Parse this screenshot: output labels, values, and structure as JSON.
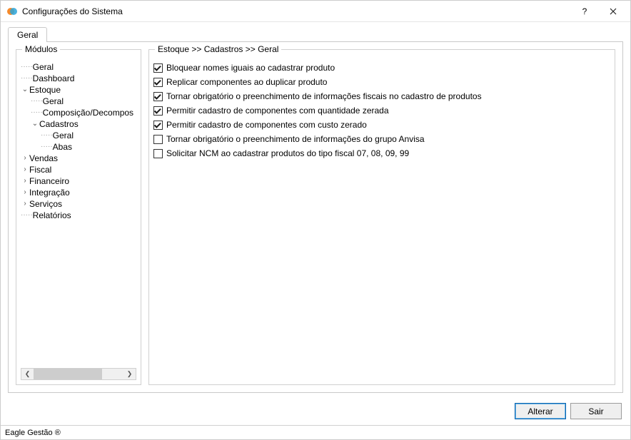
{
  "window": {
    "title": "Configurações do Sistema"
  },
  "tabs": {
    "geral": "Geral"
  },
  "sidebar": {
    "legend": "Módulos",
    "items": {
      "geral": "Geral",
      "dashboard": "Dashboard",
      "estoque": "Estoque",
      "estoque_geral": "Geral",
      "estoque_composicao": "Composição/Decompos",
      "estoque_cadastros": "Cadastros",
      "estoque_cadastros_geral": "Geral",
      "estoque_cadastros_abas": "Abas",
      "vendas": "Vendas",
      "fiscal": "Fiscal",
      "financeiro": "Financeiro",
      "integracao": "Integração",
      "servicos": "Serviços",
      "relatorios": "Relatórios"
    }
  },
  "content": {
    "breadcrumb": "Estoque >> Cadastros >> Geral",
    "options": [
      {
        "checked": true,
        "label": "Bloquear nomes iguais ao cadastrar produto"
      },
      {
        "checked": true,
        "label": "Replicar componentes ao duplicar produto"
      },
      {
        "checked": true,
        "label": "Tornar obrigatório o preenchimento de informações fiscais no cadastro de produtos"
      },
      {
        "checked": true,
        "label": "Permitir cadastro de componentes com quantidade zerada"
      },
      {
        "checked": true,
        "label": "Permitir cadastro de componentes com custo zerado"
      },
      {
        "checked": false,
        "label": "Tornar obrigatório o preenchimento de informações do grupo Anvisa"
      },
      {
        "checked": false,
        "label": "Solicitar NCM ao cadastrar produtos do tipo fiscal 07, 08, 09, 99"
      }
    ]
  },
  "footer": {
    "alterar": "Alterar",
    "sair": "Sair"
  },
  "statusbar": {
    "text": "Eagle Gestão ®"
  }
}
